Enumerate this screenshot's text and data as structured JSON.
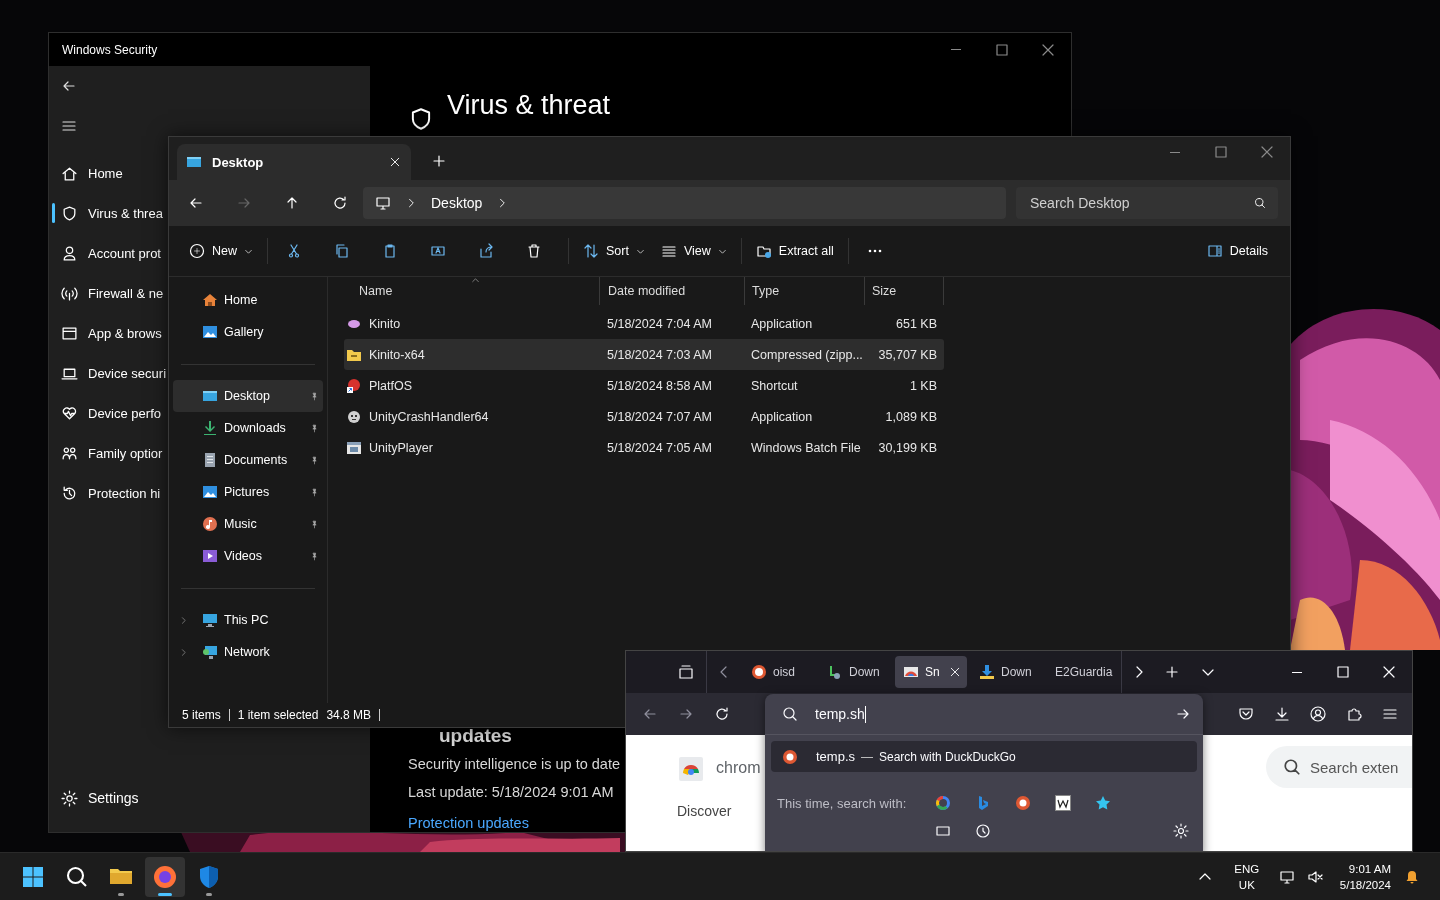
{
  "security": {
    "title": "Windows Security",
    "nav": [
      {
        "label": "Home",
        "selected": false
      },
      {
        "label": "Virus & threa",
        "selected": true
      },
      {
        "label": "Account prot",
        "selected": false
      },
      {
        "label": "Firewall & ne",
        "selected": false
      },
      {
        "label": "App & brows",
        "selected": false
      },
      {
        "label": "Device securi",
        "selected": false
      },
      {
        "label": "Device perfo",
        "selected": false
      },
      {
        "label": "Family optior",
        "selected": false
      },
      {
        "label": "Protection hi",
        "selected": false
      }
    ],
    "settings": "Settings",
    "heading": "Virus & threat",
    "updates_heading": "updates",
    "status": "Security intelligence is up to date",
    "last_update": "Last update: 5/18/2024 9:01 AM",
    "link": "Protection updates"
  },
  "explorer": {
    "tab": "Desktop",
    "breadcrumb": "Desktop",
    "search": {
      "placeholder": "Search Desktop"
    },
    "commands": {
      "new": "New",
      "sort": "Sort",
      "view": "View",
      "extract": "Extract all",
      "details": "Details"
    },
    "nav_groups": [
      {
        "items": [
          {
            "label": "Home",
            "selected": false,
            "pinned": false,
            "expandable": false
          },
          {
            "label": "Gallery",
            "selected": false,
            "pinned": false,
            "expandable": false
          }
        ]
      },
      {
        "items": [
          {
            "label": "Desktop",
            "selected": true,
            "pinned": true,
            "expandable": false
          },
          {
            "label": "Downloads",
            "selected": false,
            "pinned": true,
            "expandable": false
          },
          {
            "label": "Documents",
            "selected": false,
            "pinned": true,
            "expandable": false
          },
          {
            "label": "Pictures",
            "selected": false,
            "pinned": true,
            "expandable": false
          },
          {
            "label": "Music",
            "selected": false,
            "pinned": true,
            "expandable": false
          },
          {
            "label": "Videos",
            "selected": false,
            "pinned": true,
            "expandable": false
          }
        ]
      },
      {
        "items": [
          {
            "label": "This PC",
            "selected": false,
            "pinned": false,
            "expandable": true
          },
          {
            "label": "Network",
            "selected": false,
            "pinned": false,
            "expandable": true
          }
        ]
      }
    ],
    "columns": [
      "Name",
      "Date modified",
      "Type",
      "Size"
    ],
    "rows": [
      {
        "name": "Kinito",
        "date": "5/18/2024 7:04 AM",
        "type": "Application",
        "size": "651 KB",
        "selected": false
      },
      {
        "name": "Kinito-x64",
        "date": "5/18/2024 7:03 AM",
        "type": "Compressed (zipp...",
        "size": "35,707 KB",
        "selected": true
      },
      {
        "name": "PlatfOS",
        "date": "5/18/2024 8:58 AM",
        "type": "Shortcut",
        "size": "1 KB",
        "selected": false
      },
      {
        "name": "UnityCrashHandler64",
        "date": "5/18/2024 7:07 AM",
        "type": "Application",
        "size": "1,089 KB",
        "selected": false
      },
      {
        "name": "UnityPlayer",
        "date": "5/18/2024 7:05 AM",
        "type": "Windows Batch File",
        "size": "30,199 KB",
        "selected": false
      }
    ],
    "status": {
      "count": "5 items",
      "selection": "1 item selected",
      "size": "34.8 MB"
    }
  },
  "browser": {
    "tabs": [
      {
        "label": "oisd",
        "selected": false
      },
      {
        "label": "Down",
        "selected": false
      },
      {
        "label": "Sn",
        "selected": true
      },
      {
        "label": "Down",
        "selected": false
      },
      {
        "label": "E2Guardia",
        "selected": false
      }
    ],
    "url": {
      "value": "temp.sh"
    },
    "suggestion": {
      "query": "temp.s",
      "dash": "—",
      "action": "Search with DuckDuckGo"
    },
    "one_off_label": "This time, search with:",
    "page": {
      "brand": "chrom",
      "nav": "Discover",
      "search": {
        "placeholder": "Search exten"
      }
    }
  },
  "taskbar": {
    "apps": [
      {
        "running": true,
        "selected": false
      },
      {
        "running": true,
        "selected": true
      },
      {
        "running": true,
        "selected": false
      }
    ],
    "language": "ENG",
    "region": "UK",
    "time": "9:01 AM",
    "date": "5/18/2024"
  }
}
